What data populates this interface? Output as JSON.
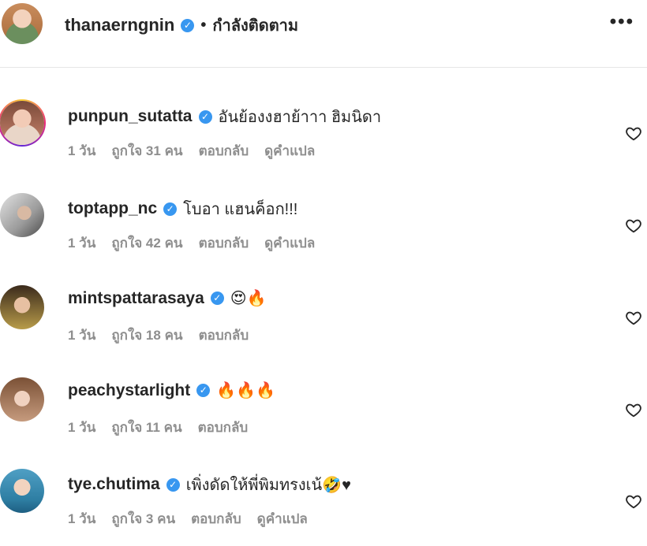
{
  "header": {
    "username": "thanaerngnin",
    "separator": "•",
    "follow_status": "กำลังติดตาม",
    "more_label": "•••"
  },
  "comments": [
    {
      "username": "punpun_sutatta",
      "text": "อันย้องงฮาย้าาา ฮิมนิดา",
      "time": "1 วัน",
      "likes": "ถูกใจ 31 คน",
      "reply": "ตอบกลับ",
      "translate": "ดูคำแปล",
      "has_story_ring": true
    },
    {
      "username": "toptapp_nc",
      "text": "โบอา แฮนค็อก!!!",
      "time": "1 วัน",
      "likes": "ถูกใจ 42 คน",
      "reply": "ตอบกลับ",
      "translate": "ดูคำแปล",
      "has_story_ring": false
    },
    {
      "username": "mintspattarasaya",
      "text": "😍🔥",
      "time": "1 วัน",
      "likes": "ถูกใจ 18 คน",
      "reply": "ตอบกลับ",
      "has_story_ring": false
    },
    {
      "username": "peachystarlight",
      "text": "🔥🔥🔥",
      "time": "1 วัน",
      "likes": "ถูกใจ 11 คน",
      "reply": "ตอบกลับ",
      "has_story_ring": false
    },
    {
      "username": "tye.chutima",
      "text": "เพิ่งดัดให้พี่พิมทรงเน้🤣♥",
      "time": "1 วัน",
      "likes": "ถูกใจ 3 คน",
      "reply": "ตอบกลับ",
      "translate": "ดูคำแปล",
      "has_story_ring": false
    }
  ],
  "icons": {
    "verified": "verified-badge-icon",
    "like": "heart-outline-icon",
    "more": "more-options-icon"
  },
  "colors": {
    "verified": "#3897f0",
    "text": "#262626",
    "secondary": "#8e8e8e"
  }
}
